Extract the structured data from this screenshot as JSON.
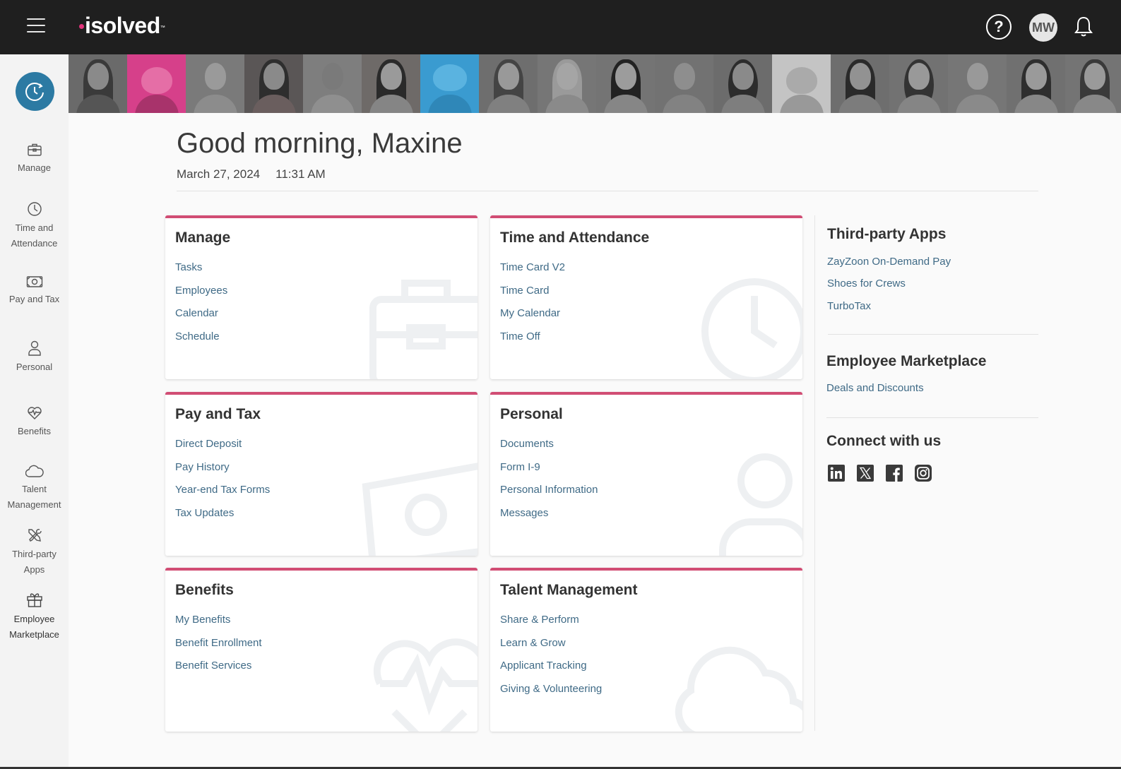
{
  "header": {
    "logo_text": "isolved",
    "logo_tm": "™",
    "help_symbol": "?",
    "avatar_initials": "MW",
    "icons": [
      "menu-icon",
      "help-icon",
      "bell-icon"
    ]
  },
  "colors": {
    "topbar": "#1f1f1f",
    "accent_pink": "#d14d74",
    "brand_dot": "#e0337a",
    "primary_blue": "#2c7aa3",
    "link": "#3f6a86"
  },
  "sidebar": {
    "top_button_icon": "history-icon",
    "items": [
      {
        "label_1": "Manage",
        "label_2": "",
        "icon": "briefcase-icon"
      },
      {
        "label_1": "Time and",
        "label_2": "Attendance",
        "icon": "clock-icon"
      },
      {
        "label_1": "Pay and Tax",
        "label_2": "",
        "icon": "money-icon"
      },
      {
        "label_1": "Personal",
        "label_2": "",
        "icon": "person-icon"
      },
      {
        "label_1": "Benefits",
        "label_2": "",
        "icon": "heart-pulse-icon"
      },
      {
        "label_1": "Talent",
        "label_2": "Management",
        "icon": "cloud-icon"
      },
      {
        "label_1": "Third-party",
        "label_2": "Apps",
        "icon": "tools-icon"
      },
      {
        "label_1": "Employee",
        "label_2": "Marketplace",
        "icon": "gift-icon"
      }
    ]
  },
  "main": {
    "greeting": "Good morning, Maxine",
    "date": "March 27, 2024",
    "time": "11:31 AM",
    "cards": [
      {
        "title": "Manage",
        "links": [
          "Tasks",
          "Employees",
          "Calendar",
          "Schedule"
        ]
      },
      {
        "title": "Time and Attendance",
        "links": [
          "Time Card V2",
          "Time Card",
          "My Calendar",
          "Time Off"
        ]
      },
      {
        "title": "Pay and Tax",
        "links": [
          "Direct Deposit",
          "Pay History",
          "Year-end Tax Forms",
          "Tax Updates"
        ]
      },
      {
        "title": "Personal",
        "links": [
          "Documents",
          "Form I-9",
          "Personal Information",
          "Messages"
        ]
      },
      {
        "title": "Benefits",
        "links": [
          "My Benefits",
          "Benefit Enrollment",
          "Benefit Services"
        ]
      },
      {
        "title": "Talent Management",
        "links": [
          "Share & Perform",
          "Learn & Grow",
          "Applicant Tracking",
          "Giving & Volunteering"
        ]
      }
    ]
  },
  "right_panel": {
    "third_party": {
      "title": "Third-party Apps",
      "links": [
        "ZayZoon On-Demand Pay",
        "Shoes for Crews",
        "TurboTax"
      ]
    },
    "marketplace": {
      "title": "Employee Marketplace",
      "links": [
        "Deals and Discounts"
      ]
    },
    "connect": {
      "title": "Connect with us",
      "icons": [
        "linkedin-icon",
        "x-icon",
        "facebook-icon",
        "instagram-icon"
      ]
    }
  }
}
